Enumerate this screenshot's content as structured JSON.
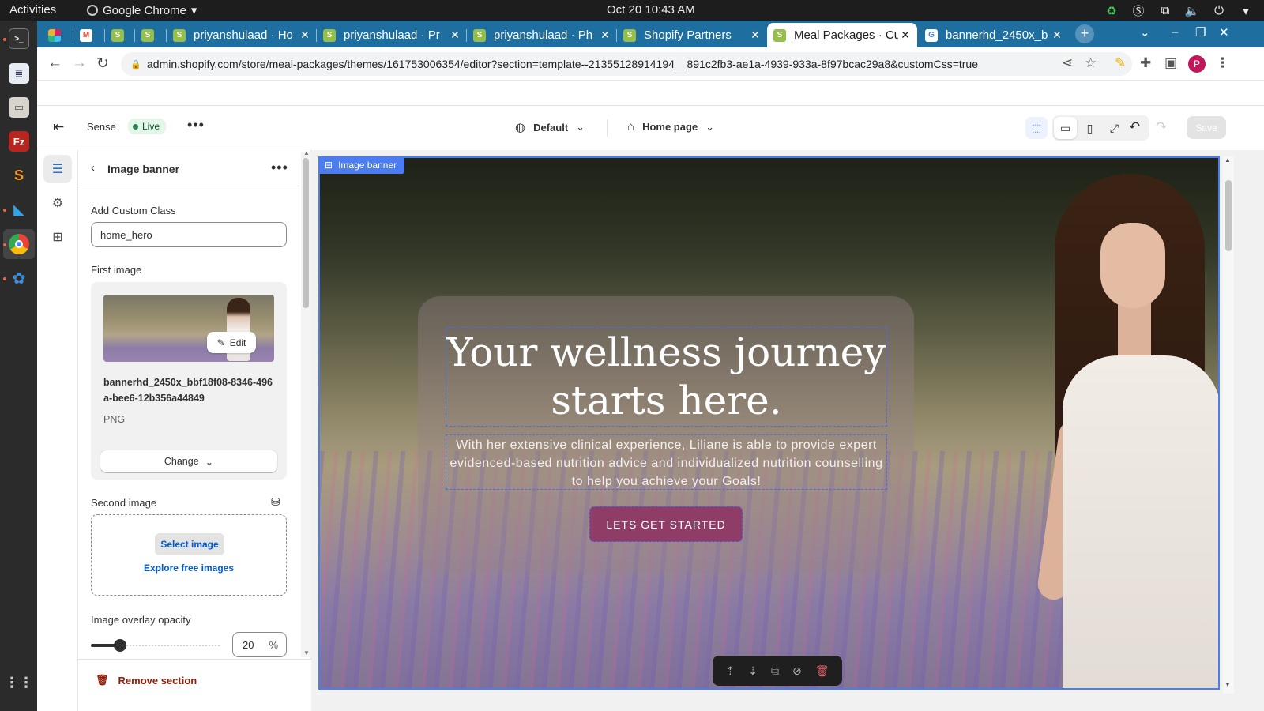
{
  "system": {
    "activities": "Activities",
    "app_name": "Google Chrome",
    "clock": "Oct 20  10:43 AM"
  },
  "browser": {
    "tabs": [
      {
        "title": "",
        "favicon": "slack-icon"
      },
      {
        "title": "",
        "favicon": "gmail-icon"
      },
      {
        "title": "",
        "favicon": "shopify-icon"
      },
      {
        "title": "",
        "favicon": "shopify-icon"
      },
      {
        "title": "priyanshulaad · Ho",
        "favicon": "shopify-icon"
      },
      {
        "title": "priyanshulaad · Pr",
        "favicon": "shopify-icon"
      },
      {
        "title": "priyanshulaad · Ph",
        "favicon": "shopify-icon"
      },
      {
        "title": "Shopify Partners",
        "favicon": "shopify-icon"
      },
      {
        "title": "Meal Packages · Cu",
        "favicon": "shopify-icon",
        "active": true
      },
      {
        "title": "bannerhd_2450x_b",
        "favicon": "google-icon"
      }
    ],
    "url_host": "admin.shopify.com",
    "url_path": "/store/meal-packages/themes/161753006354/editor?section=template--21355128914194__891c2fb3-ae1a-4939-933a-8f97bcac29a8&customCss=true",
    "profile_initial": "P"
  },
  "editor": {
    "theme_name": "Sense",
    "live_badge": "Live",
    "language_dropdown": "Default",
    "page_dropdown": "Home page",
    "save_label": "Save"
  },
  "panel": {
    "title": "Image banner",
    "custom_class_label": "Add Custom Class",
    "custom_class_value": "home_hero",
    "first_image_label": "First image",
    "edit_label": "Edit",
    "file_name": "bannerhd_2450x_bbf18f08-8346-496a-bee6-12b356a44849",
    "file_type": "PNG",
    "change_label": "Change",
    "second_image_label": "Second image",
    "select_image_label": "Select image",
    "explore_label": "Explore free images",
    "opacity_label": "Image overlay opacity",
    "opacity_value": "20",
    "opacity_unit": "%",
    "opacity_fraction": 0.2,
    "remove_label": "Remove section"
  },
  "preview": {
    "section_tag": "Image banner",
    "headline": "Your wellness journey starts here.",
    "subtext": "With her extensive clinical experience, Liliane is able to provide expert evidenced-based nutrition advice and individualized nutrition counselling to help you achieve your Goals!",
    "cta_label": "LETS GET STARTED",
    "cta_color": "#8f3d66"
  },
  "colors": {
    "accent_blue": "#4b7df0",
    "link_blue": "#005bd3",
    "live_green": "#29845a",
    "danger": "#8e1f0b",
    "chrome_tabstrip": "#1e6fa0"
  }
}
